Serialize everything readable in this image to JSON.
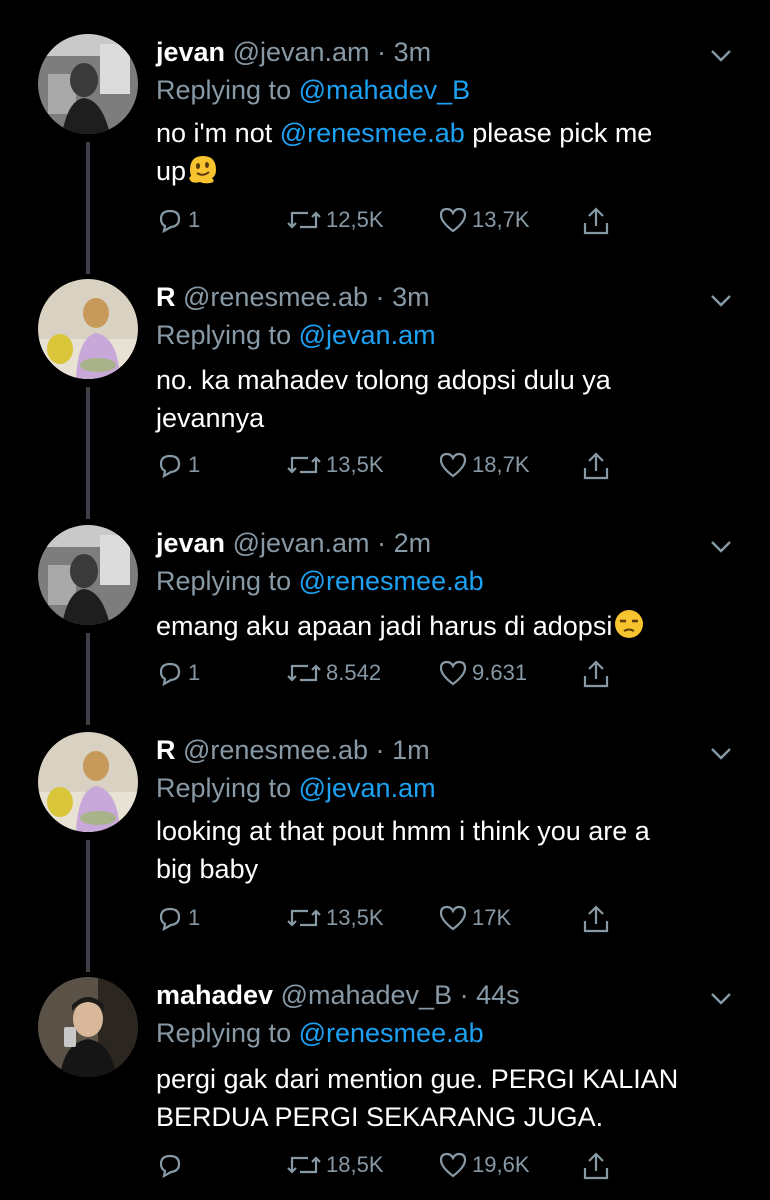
{
  "colors": {
    "background": "#000000",
    "text": "#ffffff",
    "muted": "#8899a6",
    "link": "#1da1f2",
    "line": "#3d4148"
  },
  "tweets": [
    {
      "name": "jevan",
      "handle": "@jevan.am",
      "dot": "·",
      "time": "3m",
      "reply_prefix": "Replying to",
      "reply_to": "@mahadev_B",
      "body_lines": [
        [
          "no i'm not ",
          "@renesmee.ab",
          " please pick me"
        ],
        [
          "up"
        ]
      ],
      "emoji": "melting-face-emoji",
      "reply_count": "1",
      "retweets": "12,5K",
      "likes": "13,7K",
      "avatar": "jevan-avatar"
    },
    {
      "name": "R",
      "handle": "@renesmee.ab",
      "dot": "·",
      "time": "3m",
      "reply_prefix": "Replying to",
      "reply_to": "@jevan.am",
      "body_lines": [
        "no. ka mahadev tolong adopsi dulu ya",
        "jevannya"
      ],
      "reply_count": "1",
      "retweets": "13,5K",
      "likes": "18,7K",
      "avatar": "renesmee-avatar"
    },
    {
      "name": "jevan",
      "handle": "@jevan.am",
      "dot": "·",
      "time": "2m",
      "reply_prefix": "Replying to",
      "reply_to": "@renesmee.ab",
      "body_lines": [
        "emang aku apaan jadi harus di adopsi"
      ],
      "emoji": "unamused-face-emoji",
      "reply_count": "1",
      "retweets": "8.542",
      "likes": "9.631",
      "avatar": "jevan-avatar"
    },
    {
      "name": "R",
      "handle": "@renesmee.ab",
      "dot": "·",
      "time": "1m",
      "reply_prefix": "Replying to",
      "reply_to": "@jevan.am",
      "body_lines": [
        "looking at that pout hmm i think you are a",
        "big baby"
      ],
      "reply_count": "1",
      "retweets": "13,5K",
      "likes": "17K",
      "avatar": "renesmee-avatar"
    },
    {
      "name": "mahadev",
      "handle": "@mahadev_B",
      "dot": "·",
      "time": "44s",
      "reply_prefix": "Replying to",
      "reply_to": "@renesmee.ab",
      "body_lines": [
        "pergi gak dari mention gue. PERGI KALIAN",
        "BERDUA PERGI SEKARANG JUGA."
      ],
      "reply_count": "",
      "retweets": "18,5K",
      "likes": "19,6K",
      "avatar": "mahadev-avatar"
    }
  ]
}
